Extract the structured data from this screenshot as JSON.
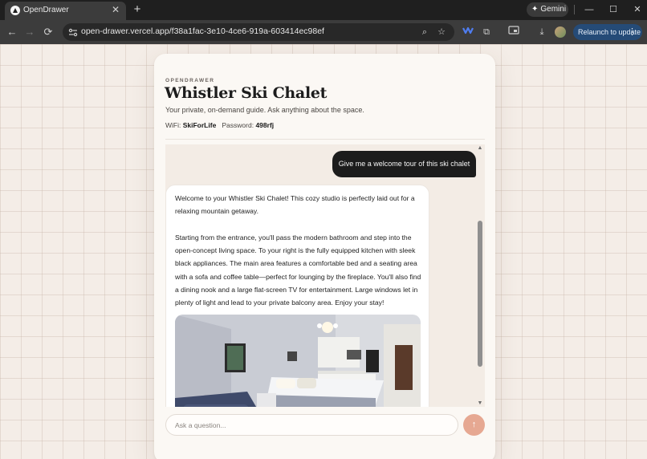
{
  "browser": {
    "tab_title": "OpenDrawer",
    "tab_close": "✕",
    "new_tab": "+",
    "gemini_label": "Gemini",
    "url": "open-drawer.vercel.app/f38a1fac-3e10-4ce6-919a-603414ec98ef",
    "relaunch_label": "Relaunch to update",
    "icons": {
      "back": "←",
      "forward": "→",
      "reload": "⟳",
      "zoom": "⌕",
      "bookmark": "☆",
      "extension": "⧉",
      "download": "⤓",
      "minimize": "—",
      "maximize": "☐",
      "close": "✕",
      "menu": "⋮"
    }
  },
  "page": {
    "brand": "OPENDRAWER",
    "title": "Whistler Ski Chalet",
    "subtitle": "Your private, on-demand guide. Ask anything about the space.",
    "wifi_label": "WiFi:",
    "wifi_name": "SkiForLife",
    "password_label": "Password:",
    "password": "498rfj"
  },
  "chat": {
    "user_message": "Give me a welcome tour of this ski chalet",
    "assistant_paragraph_1": "Welcome to your Whistler Ski Chalet! This cozy studio is perfectly laid out for a relaxing mountain getaway.",
    "assistant_paragraph_2": "Starting from the entrance, you'll pass the modern bathroom and step into the open-concept living space. To your right is the fully equipped kitchen with sleek black appliances. The main area features a comfortable bed and a seating area with a sofa and coffee table—perfect for lounging by the fireplace. You'll also find a dining nook and a large flat-screen TV for entertainment. Large windows let in plenty of light and lead to your private balcony area. Enjoy your stay!"
  },
  "input": {
    "placeholder": "Ask a question...",
    "send_icon": "↑"
  },
  "colors": {
    "accent": "#e6a892",
    "user_bubble": "#1c1c1c",
    "relaunch": "#254b77"
  }
}
